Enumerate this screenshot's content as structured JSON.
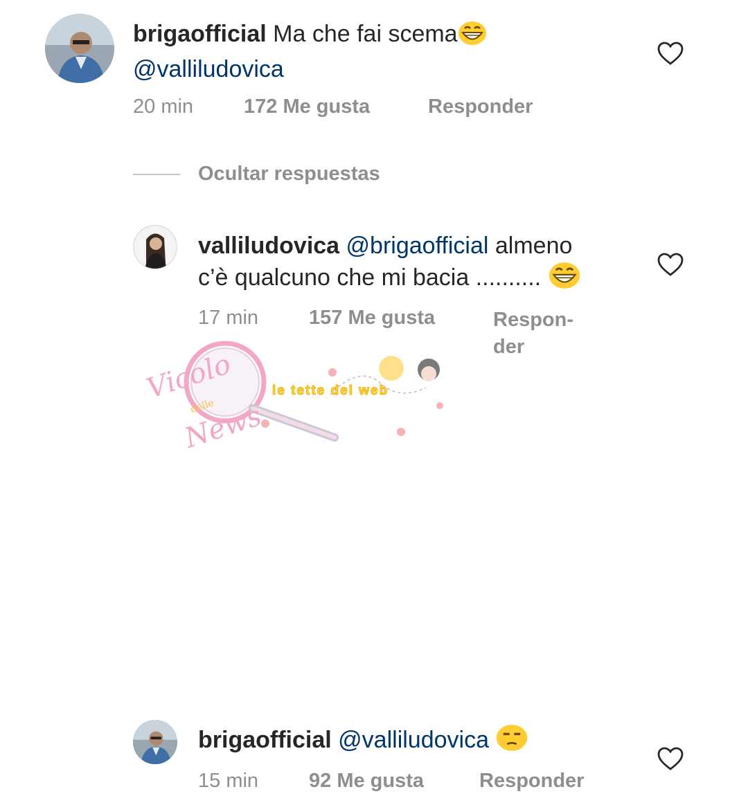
{
  "comments": [
    {
      "username": "brigaofficial",
      "text": "Ma che fai scema",
      "emoji": "grinning-emoji",
      "mention": "@valliludovica",
      "time": "20 min",
      "likes": "172 Me gusta",
      "reply_label": "Responder"
    },
    {
      "username": "valliludovica",
      "mention": "@brigaofficial",
      "text_line1_rest": "almeno",
      "text_line2": "c’è qualcuno che mi bacia ..........",
      "emoji": "grinning-emoji",
      "time": "17 min",
      "likes": "157 Me gusta",
      "reply_line1": "Respon-",
      "reply_line2": "der"
    },
    {
      "username": "brigaofficial",
      "mention": "@valliludovica",
      "emoji": "unamused-emoji",
      "time": "15 min",
      "likes": "92 Me gusta",
      "reply_label": "Responder"
    }
  ],
  "hide_replies_label": "Ocultar respuestas",
  "watermark": {
    "logo_text_1": "Vicolo",
    "logo_text_2": "delle",
    "logo_text_3": "News",
    "banner_text": "le tette del web"
  },
  "colors": {
    "username": "#262626",
    "mention": "#003569",
    "meta": "#8e8e8e",
    "watermark_pink": "#f2a7c6",
    "watermark_yellow": "#ffd54a"
  }
}
